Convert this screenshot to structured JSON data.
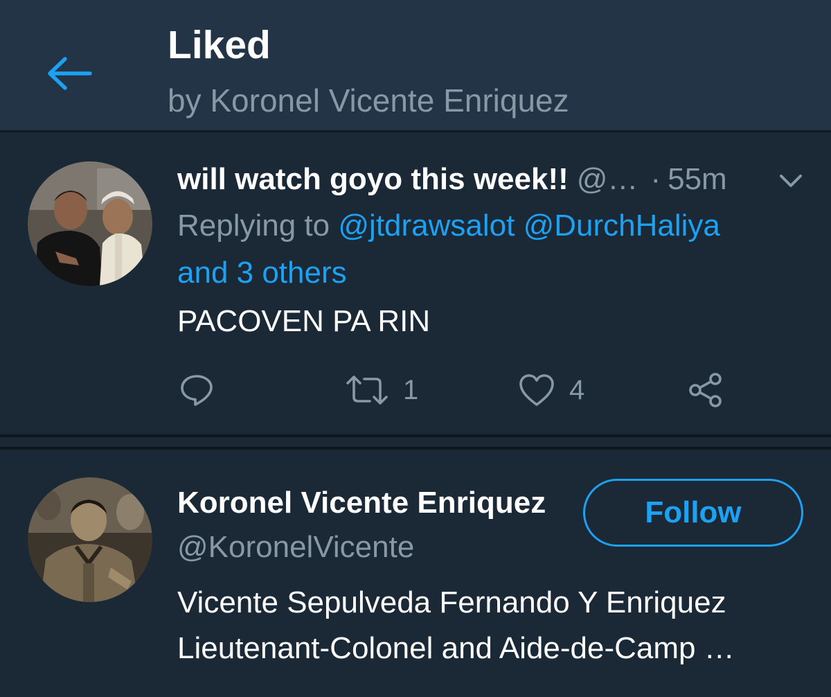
{
  "header": {
    "title": "Liked",
    "subtitle": "by Koronel Vicente Enriquez"
  },
  "tweet": {
    "name": "will watch goyo this week!!",
    "handle": "@…",
    "separator": "·",
    "time": "55m",
    "replying_prefix": "Replying to",
    "mention_1": "@jtdrawsalot",
    "mention_2": "@DurchHaliya",
    "others": "and 3 others",
    "text": "PACOVEN PA RIN",
    "retweet_count": "1",
    "like_count": "4"
  },
  "user": {
    "name": "Koronel Vicente Enriquez",
    "handle": "@KoronelVicente",
    "follow_label": "Follow",
    "bio_line1": "Vicente Sepulveda Fernando Y Enriquez",
    "bio_line2": "Lieutenant-Colonel and Aide-de-Camp …"
  },
  "colors": {
    "background": "#1b2836",
    "header": "#243447",
    "accent": "#1da1f2",
    "muted": "#8899a6"
  },
  "icons": {
    "back": "arrow-left-icon",
    "caret": "chevron-down-icon",
    "reply": "reply-icon",
    "retweet": "retweet-icon",
    "like": "heart-icon",
    "share": "share-icon"
  }
}
